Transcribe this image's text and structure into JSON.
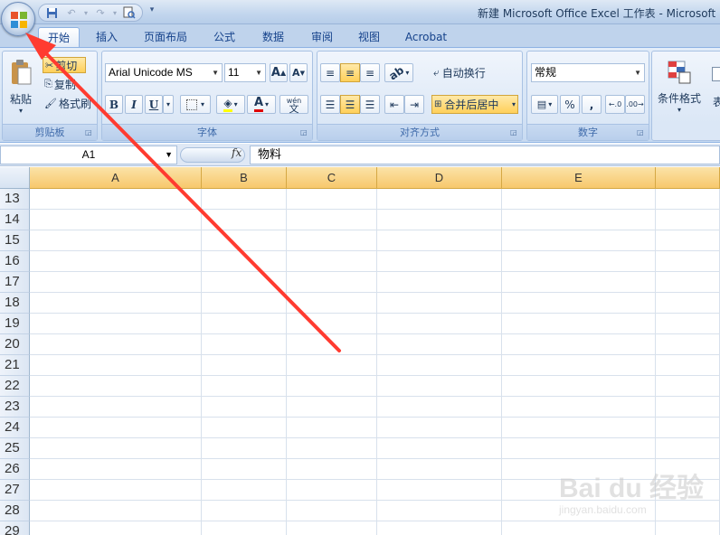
{
  "window": {
    "title": "新建 Microsoft Office Excel 工作表 - Microsoft"
  },
  "quick_access": {
    "save_icon": "save-icon",
    "undo_icon": "undo-icon",
    "redo_icon": "redo-icon",
    "print_preview_icon": "print-preview-icon"
  },
  "tabs": [
    {
      "label": "开始",
      "active": true
    },
    {
      "label": "插入"
    },
    {
      "label": "页面布局"
    },
    {
      "label": "公式"
    },
    {
      "label": "数据"
    },
    {
      "label": "审阅"
    },
    {
      "label": "视图"
    },
    {
      "label": "Acrobat"
    }
  ],
  "ribbon": {
    "clipboard": {
      "label": "剪贴板",
      "paste": "粘贴",
      "cut": "剪切",
      "copy": "复制",
      "format_painter": "格式刷"
    },
    "font": {
      "label": "字体",
      "font_name": "Arial Unicode MS",
      "font_size": "11",
      "bold": "B",
      "italic": "I",
      "underline": "U",
      "phonetic": "wén"
    },
    "alignment": {
      "label": "对齐方式",
      "wrap_text": "自动换行",
      "merge_center": "合并后居中"
    },
    "number": {
      "label": "数字",
      "format": "常规",
      "percent": "%",
      "comma": ","
    },
    "styles": {
      "conditional_format": "条件格式",
      "table_format_partial": "表"
    }
  },
  "formula_bar": {
    "name_box": "A1",
    "fx": "fx",
    "value": "物料"
  },
  "sheet": {
    "columns": [
      "A",
      "B",
      "C",
      "D",
      "E"
    ],
    "rows": [
      "13",
      "14",
      "15",
      "16",
      "17",
      "18",
      "19",
      "20",
      "21",
      "22",
      "23",
      "24",
      "25",
      "26",
      "27",
      "28",
      "29"
    ]
  },
  "watermark": {
    "brand": "Bai du 经验",
    "url": "jingyan.baidu.com"
  },
  "colors": {
    "accent": "#ff3b30",
    "selected_header": "#f7c86c"
  }
}
